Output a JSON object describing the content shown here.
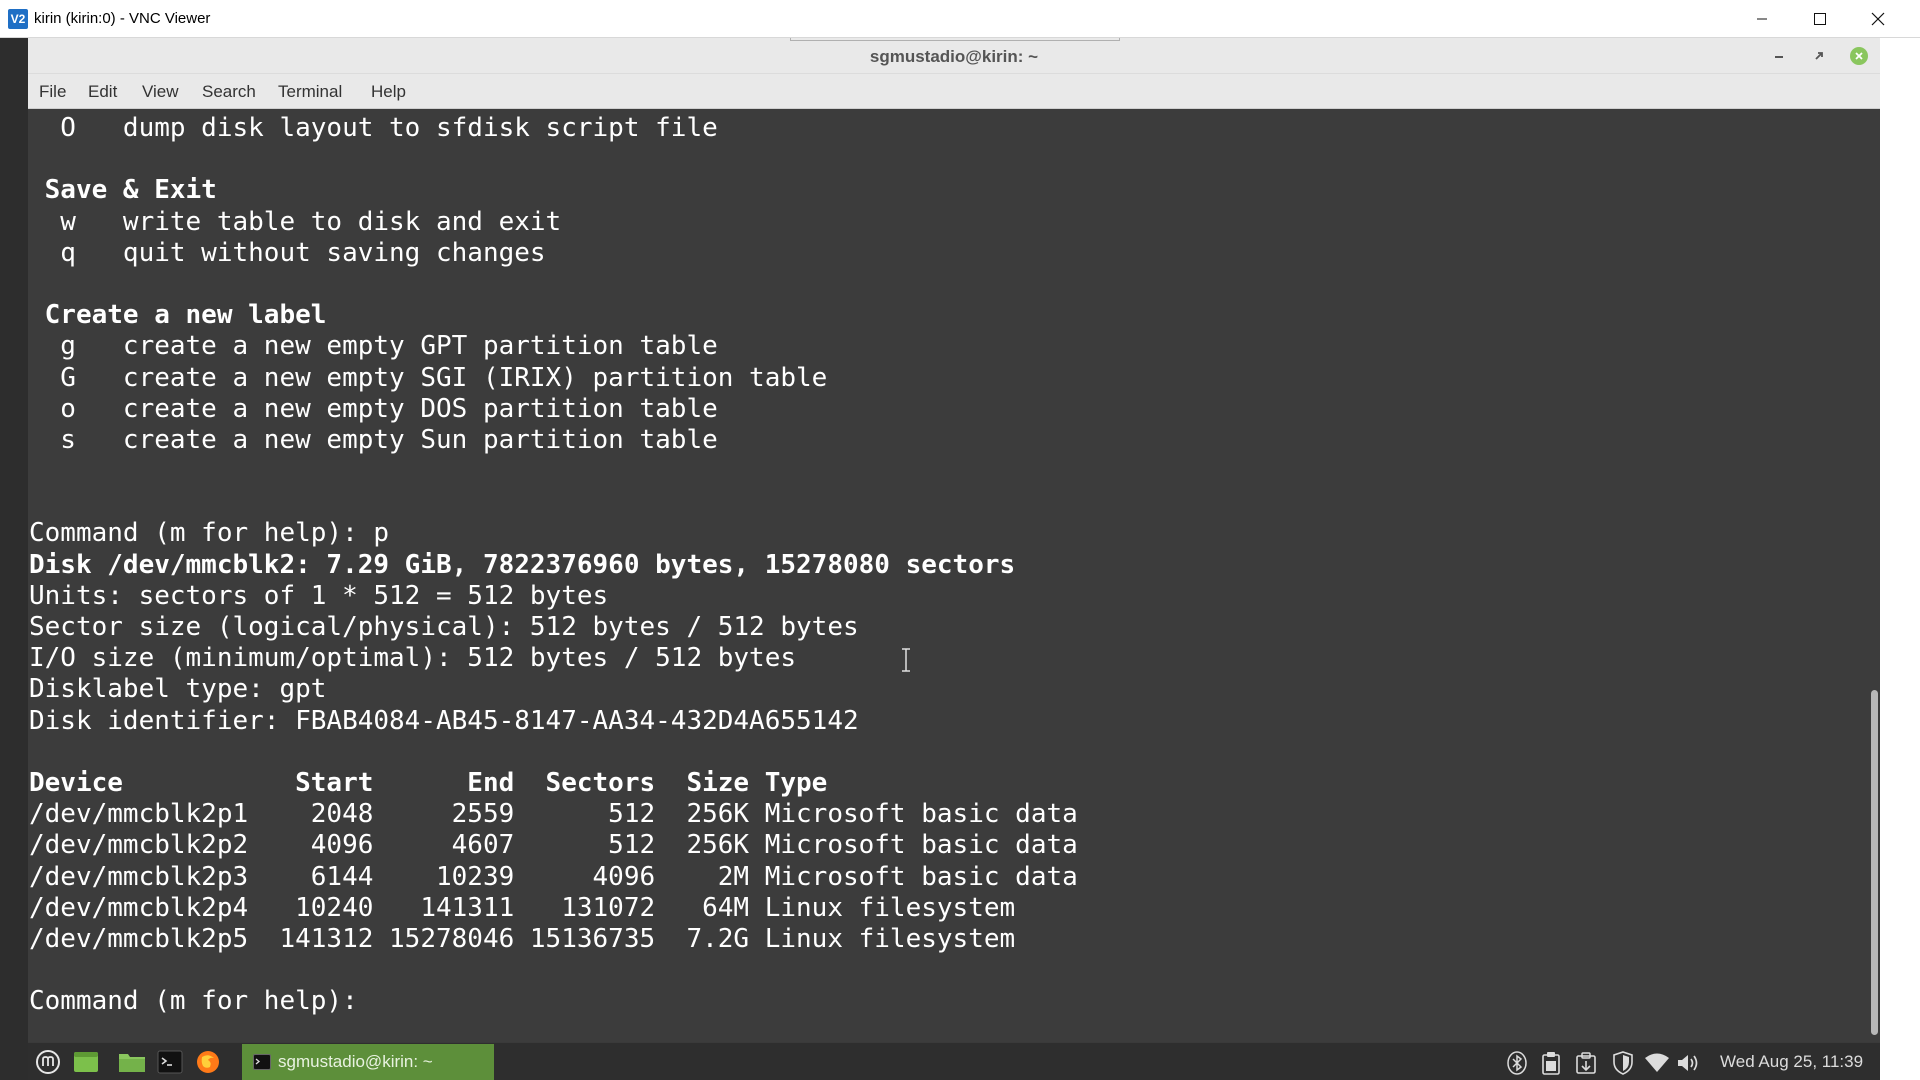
{
  "vnc": {
    "logo": "V2",
    "title": "kirin (kirin:0) - VNC Viewer"
  },
  "terminal": {
    "title": "sgmustadio@kirin: ~",
    "menu": [
      "File",
      "Edit",
      "View",
      "Search",
      "Terminal",
      "Help"
    ],
    "lines": [
      {
        "text": "  O   dump disk layout to sfdisk script file",
        "bold": false
      },
      {
        "text": "",
        "bold": false
      },
      {
        "text": " Save & Exit",
        "bold": true
      },
      {
        "text": "  w   write table to disk and exit",
        "bold": false
      },
      {
        "text": "  q   quit without saving changes",
        "bold": false
      },
      {
        "text": "",
        "bold": false
      },
      {
        "text": " Create a new label",
        "bold": true
      },
      {
        "text": "  g   create a new empty GPT partition table",
        "bold": false
      },
      {
        "text": "  G   create a new empty SGI (IRIX) partition table",
        "bold": false
      },
      {
        "text": "  o   create a new empty DOS partition table",
        "bold": false
      },
      {
        "text": "  s   create a new empty Sun partition table",
        "bold": false
      },
      {
        "text": "",
        "bold": false
      },
      {
        "text": "",
        "bold": false
      },
      {
        "text": "Command (m for help): p",
        "bold": false
      },
      {
        "text": "Disk /dev/mmcblk2: 7.29 GiB, 7822376960 bytes, 15278080 sectors",
        "bold": true
      },
      {
        "text": "Units: sectors of 1 * 512 = 512 bytes",
        "bold": false
      },
      {
        "text": "Sector size (logical/physical): 512 bytes / 512 bytes",
        "bold": false
      },
      {
        "text": "I/O size (minimum/optimal): 512 bytes / 512 bytes",
        "bold": false
      },
      {
        "text": "Disklabel type: gpt",
        "bold": false
      },
      {
        "text": "Disk identifier: FBAB4084-AB45-8147-AA34-432D4A655142",
        "bold": false
      },
      {
        "text": "",
        "bold": false
      },
      {
        "text": "Device           Start      End  Sectors  Size Type",
        "bold": true
      },
      {
        "text": "/dev/mmcblk2p1    2048     2559      512  256K Microsoft basic data",
        "bold": false
      },
      {
        "text": "/dev/mmcblk2p2    4096     4607      512  256K Microsoft basic data",
        "bold": false
      },
      {
        "text": "/dev/mmcblk2p3    6144    10239     4096    2M Microsoft basic data",
        "bold": false
      },
      {
        "text": "/dev/mmcblk2p4   10240   141311   131072   64M Linux filesystem",
        "bold": false
      },
      {
        "text": "/dev/mmcblk2p5  141312 15278046 15136735  7.2G Linux filesystem",
        "bold": false
      },
      {
        "text": "",
        "bold": false
      },
      {
        "text": "Command (m for help): ",
        "bold": false
      }
    ]
  },
  "taskbar": {
    "launchers": [
      "mint-menu-icon",
      "show-desktop-icon",
      "files-icon",
      "terminal-icon",
      "firefox-icon"
    ],
    "active_task": "sgmustadio@kirin: ~",
    "tray": [
      "bluetooth-icon",
      "clipboard-icon",
      "update-manager-icon",
      "shield-icon",
      "wifi-icon",
      "volume-icon"
    ],
    "clock": "Wed Aug 25, 11:39"
  },
  "colors": {
    "terminal_bg": "#3c3c3c",
    "terminal_fg": "#ffffff",
    "taskbar_bg": "#2e2e2e",
    "mint_green": "#8ac65e",
    "task_active": "#5d8f3a"
  }
}
